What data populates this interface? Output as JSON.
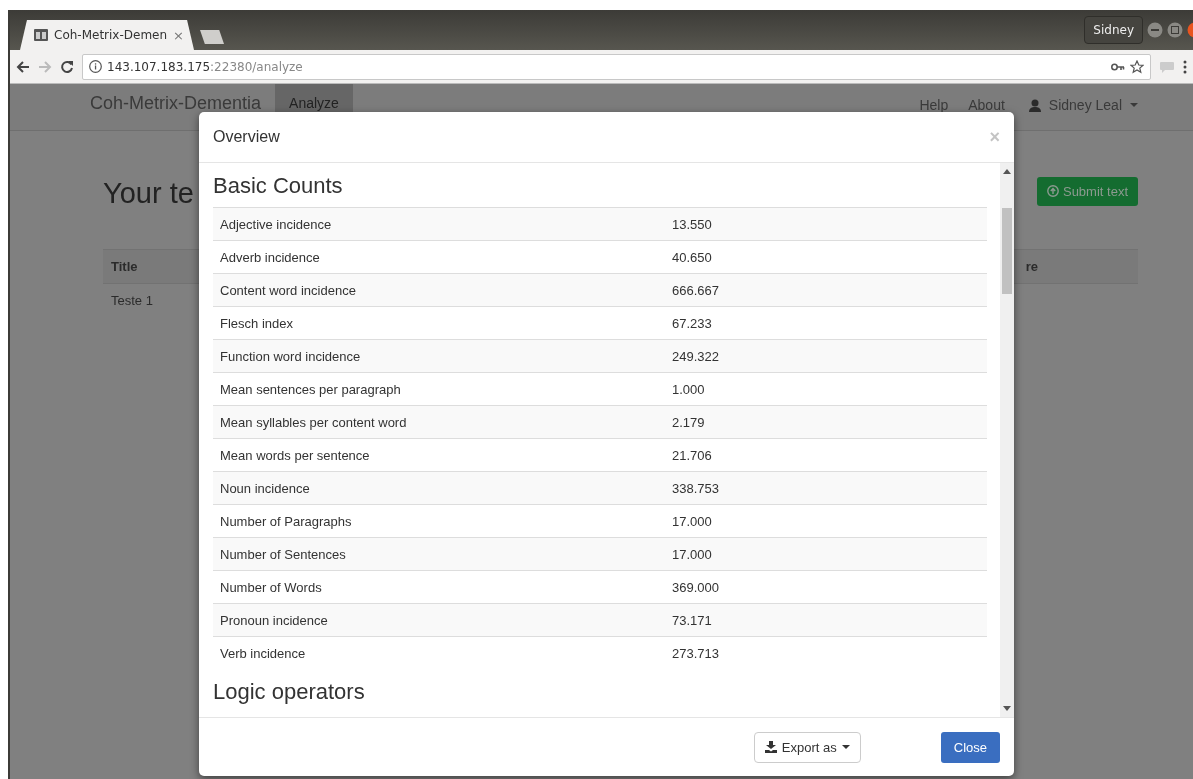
{
  "browser": {
    "tab_title": "Coh-Metrix-Demen",
    "tab_close": "×",
    "url_host": "143.107.183.175",
    "url_rest": ":22380/analyze",
    "profile": "Sidney"
  },
  "navbar": {
    "brand": "Coh-Metrix-Dementia",
    "items": [
      {
        "label": "Analyze",
        "selected": true
      }
    ],
    "links": [
      "Help",
      "About"
    ],
    "user": "Sidney Leal"
  },
  "page": {
    "heading": "Your te",
    "submit": "Submit text",
    "table": {
      "columns": [
        "Title",
        "re"
      ],
      "rows": [
        [
          "Teste 1"
        ]
      ]
    }
  },
  "modal": {
    "title": "Overview",
    "close": "×",
    "sections": [
      {
        "title": "Basic Counts",
        "rows": [
          {
            "label": "Adjective incidence",
            "value": "13.550"
          },
          {
            "label": "Adverb incidence",
            "value": "40.650"
          },
          {
            "label": "Content word incidence",
            "value": "666.667"
          },
          {
            "label": "Flesch index",
            "value": "67.233"
          },
          {
            "label": "Function word incidence",
            "value": "249.322"
          },
          {
            "label": "Mean sentences per paragraph",
            "value": "1.000"
          },
          {
            "label": "Mean syllables per content word",
            "value": "2.179"
          },
          {
            "label": "Mean words per sentence",
            "value": "21.706"
          },
          {
            "label": "Noun incidence",
            "value": "338.753"
          },
          {
            "label": "Number of Paragraphs",
            "value": "17.000"
          },
          {
            "label": "Number of Sentences",
            "value": "17.000"
          },
          {
            "label": "Number of Words",
            "value": "369.000"
          },
          {
            "label": "Pronoun incidence",
            "value": "73.171"
          },
          {
            "label": "Verb incidence",
            "value": "273.713"
          }
        ]
      },
      {
        "title": "Logic operators"
      }
    ],
    "export_button": "Export as",
    "close_button": "Close"
  }
}
